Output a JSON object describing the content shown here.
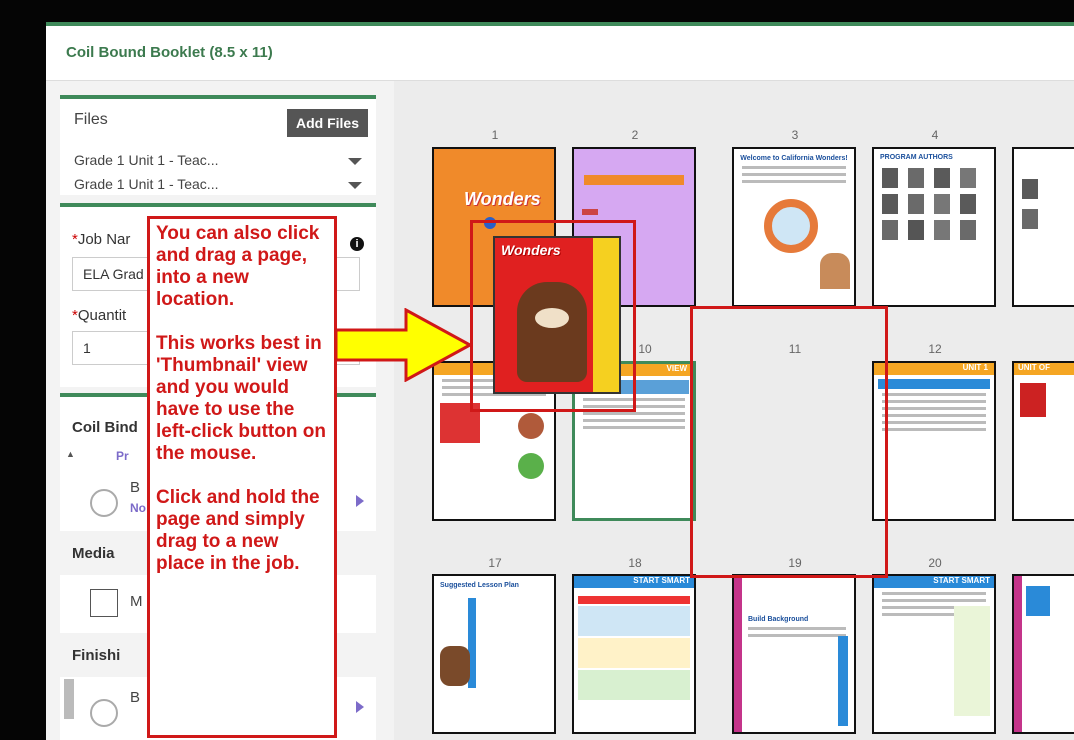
{
  "window": {
    "title": "Coil Bound Booklet (8.5 x 11)"
  },
  "files_panel": {
    "heading": "Files",
    "add_button": "Add Files",
    "items": [
      "Grade 1 Unit 1 - Teac...",
      "Grade 1 Unit 1 - Teac..."
    ]
  },
  "job_panel": {
    "job_name_label": "Job Nar",
    "job_name_value": "ELA Grad",
    "quantity_label": "Quantit",
    "quantity_value": "1",
    "required_mark": "*",
    "info_icon": "i"
  },
  "options_panel": {
    "coil_heading": "Coil Bind",
    "coil_sub": "Pr",
    "binding_option": "B",
    "binding_sub": "No",
    "media_heading": "Media",
    "media_option": "M",
    "finishing_heading": "Finishi",
    "finishing_option": "B"
  },
  "pages": {
    "row1": [
      "1",
      "2",
      "3",
      "4"
    ],
    "row2": [
      "10",
      "11",
      "12"
    ],
    "row3": [
      "17",
      "18",
      "19",
      "20"
    ]
  },
  "thumb_text": {
    "wonders": "Wonders",
    "welcome": "Welcome to California Wonders!",
    "authors": "PROGRAM AUTHORS",
    "suggested": "Suggested Lesson Plan",
    "start_smart": "START SMART",
    "unit": "UNIT 1",
    "unit_of": "UNIT OF",
    "review": "VIEW",
    "build_background": "Build Background"
  },
  "callout": {
    "para1": "You can also click and drag a page, into a new location.",
    "para2": "This works best in 'Thumbnail' view and you would have to use the left-click button on the mouse.",
    "para3": "Click and hold the page and simply drag to a new place in the job."
  },
  "colors": {
    "accent": "#3f8a5a",
    "callout_red": "#d01818",
    "arrow_yellow": "#ffff00"
  }
}
